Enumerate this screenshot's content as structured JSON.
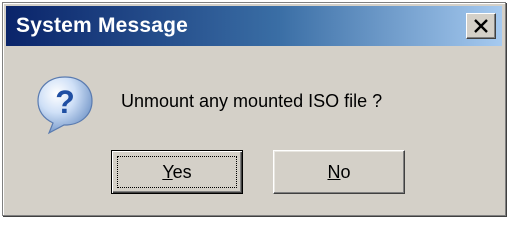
{
  "window": {
    "title": "System Message",
    "close_icon": "close-icon"
  },
  "dialog": {
    "icon": "question-icon",
    "message": "Unmount any mounted ISO file ?"
  },
  "buttons": {
    "yes": {
      "mnemonic": "Y",
      "rest": "es"
    },
    "no": {
      "mnemonic": "N",
      "rest": "o"
    }
  }
}
